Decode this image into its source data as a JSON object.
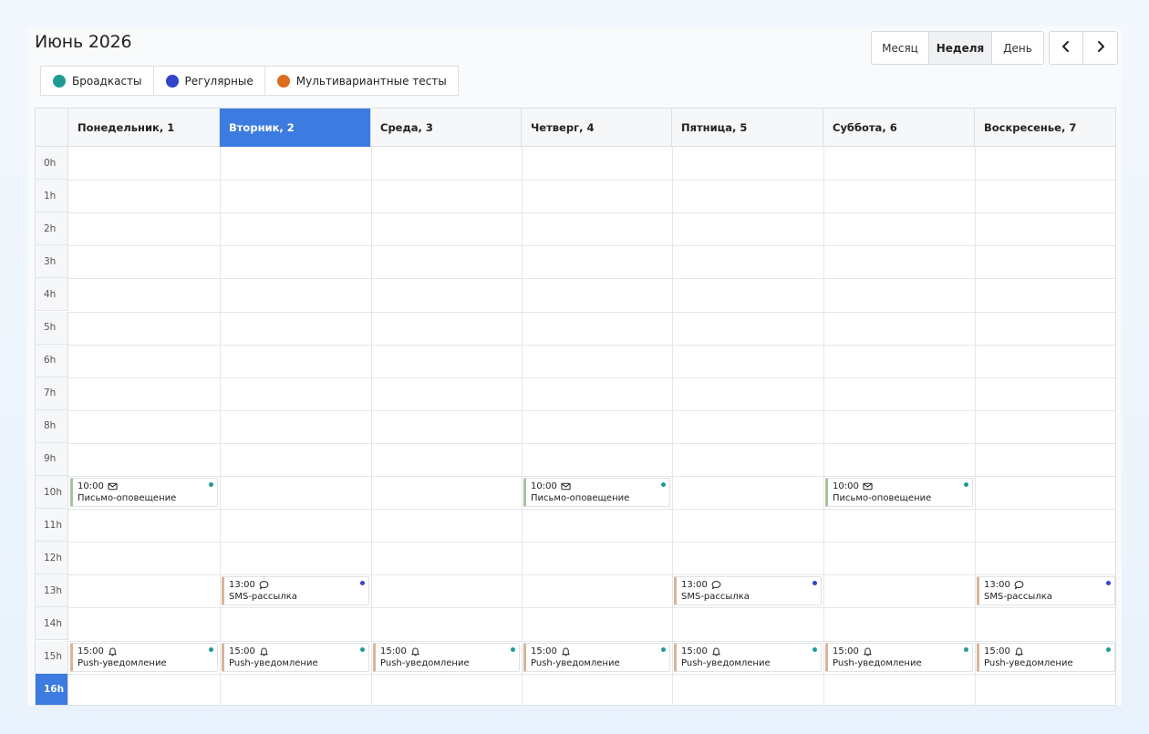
{
  "header": {
    "title": "Июнь 2026"
  },
  "colors": {
    "broadcast": "#1e9a95",
    "regular": "#3344cc",
    "multivariant": "#dd6b20",
    "today": "#3c7be0",
    "bar_email": "#a8c39a",
    "bar_other": "#d8b599"
  },
  "legend": [
    {
      "label": "Броадкасты",
      "color": "#1e9a95"
    },
    {
      "label": "Регулярные",
      "color": "#3344cc"
    },
    {
      "label": "Мультивариантные тесты",
      "color": "#dd6b20"
    }
  ],
  "views": [
    {
      "label": "Месяц",
      "active": false
    },
    {
      "label": "Неделя",
      "active": true
    },
    {
      "label": "День",
      "active": false
    }
  ],
  "nav": {
    "prev_icon": "chevron-left-icon",
    "next_icon": "chevron-right-icon"
  },
  "days": [
    {
      "label": "Понедельник, 1",
      "today": false
    },
    {
      "label": "Вторник, 2",
      "today": true
    },
    {
      "label": "Среда, 3",
      "today": false
    },
    {
      "label": "Четверг, 4",
      "today": false
    },
    {
      "label": "Пятница, 5",
      "today": false
    },
    {
      "label": "Суббота, 6",
      "today": false
    },
    {
      "label": "Воскресенье, 7",
      "today": false
    }
  ],
  "hours": [
    "0h",
    "1h",
    "2h",
    "3h",
    "4h",
    "5h",
    "6h",
    "7h",
    "8h",
    "9h",
    "10h",
    "11h",
    "12h",
    "13h",
    "14h",
    "15h",
    "16h"
  ],
  "current_hour_label": "16h",
  "events": [
    {
      "day": 0,
      "hour": 10,
      "time": "10:00",
      "icon": "mail-icon",
      "name": "Письмо-оповещение",
      "dot": "#1e9a95",
      "bar": "#a8c39a"
    },
    {
      "day": 3,
      "hour": 10,
      "time": "10:00",
      "icon": "mail-icon",
      "name": "Письмо-оповещение",
      "dot": "#1e9a95",
      "bar": "#a8c39a"
    },
    {
      "day": 5,
      "hour": 10,
      "time": "10:00",
      "icon": "mail-icon",
      "name": "Письмо-оповещение",
      "dot": "#1e9a95",
      "bar": "#a8c39a"
    },
    {
      "day": 1,
      "hour": 13,
      "time": "13:00",
      "icon": "chat-bubble-icon",
      "name": "SMS-рассылка",
      "dot": "#3344cc",
      "bar": "#d8b599"
    },
    {
      "day": 4,
      "hour": 13,
      "time": "13:00",
      "icon": "chat-bubble-icon",
      "name": "SMS-рассылка",
      "dot": "#3344cc",
      "bar": "#d8b599"
    },
    {
      "day": 6,
      "hour": 13,
      "time": "13:00",
      "icon": "chat-bubble-icon",
      "name": "SMS-рассылка",
      "dot": "#3344cc",
      "bar": "#d8b599"
    },
    {
      "day": 0,
      "hour": 15,
      "time": "15:00",
      "icon": "bell-icon",
      "name": "Push-уведомление",
      "dot": "#1e9a95",
      "bar": "#d8b599"
    },
    {
      "day": 1,
      "hour": 15,
      "time": "15:00",
      "icon": "bell-icon",
      "name": "Push-уведомление",
      "dot": "#1e9a95",
      "bar": "#d8b599"
    },
    {
      "day": 2,
      "hour": 15,
      "time": "15:00",
      "icon": "bell-icon",
      "name": "Push-уведомление",
      "dot": "#1e9a95",
      "bar": "#d8b599"
    },
    {
      "day": 3,
      "hour": 15,
      "time": "15:00",
      "icon": "bell-icon",
      "name": "Push-уведомление",
      "dot": "#1e9a95",
      "bar": "#d8b599"
    },
    {
      "day": 4,
      "hour": 15,
      "time": "15:00",
      "icon": "bell-icon",
      "name": "Push-уведомление",
      "dot": "#1e9a95",
      "bar": "#d8b599"
    },
    {
      "day": 5,
      "hour": 15,
      "time": "15:00",
      "icon": "bell-icon",
      "name": "Push-уведомление",
      "dot": "#1e9a95",
      "bar": "#d8b599"
    },
    {
      "day": 6,
      "hour": 15,
      "time": "15:00",
      "icon": "bell-icon",
      "name": "Push-уведомление",
      "dot": "#1e9a95",
      "bar": "#d8b599"
    }
  ]
}
